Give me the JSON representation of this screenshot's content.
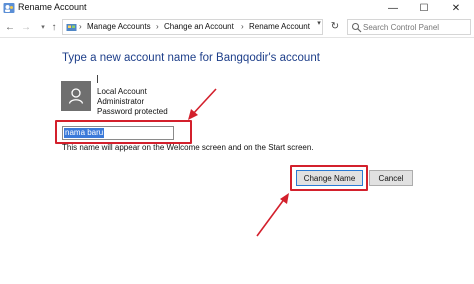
{
  "window": {
    "title": "Rename Account",
    "controls": {
      "minimize": "—",
      "maximize": "☐",
      "close": "✕"
    }
  },
  "address_bar": {
    "breadcrumbs": [
      "Manage Accounts",
      "Change an Account",
      "Rename Account"
    ],
    "separator": "›"
  },
  "search": {
    "placeholder": "Search Control Panel"
  },
  "main": {
    "heading": "Type a new account name for Bangqodir's account",
    "account": {
      "type": "Local Account",
      "role": "Administrator",
      "status": "Password protected"
    },
    "new_name_value": "nama baru",
    "hint": "This name will appear on the Welcome screen and on the Start screen.",
    "change_button": "Change Name",
    "cancel_button": "Cancel"
  },
  "colors": {
    "annotation": "#d3202c",
    "heading": "#1e3f8a",
    "selection": "#3b7ad9"
  }
}
